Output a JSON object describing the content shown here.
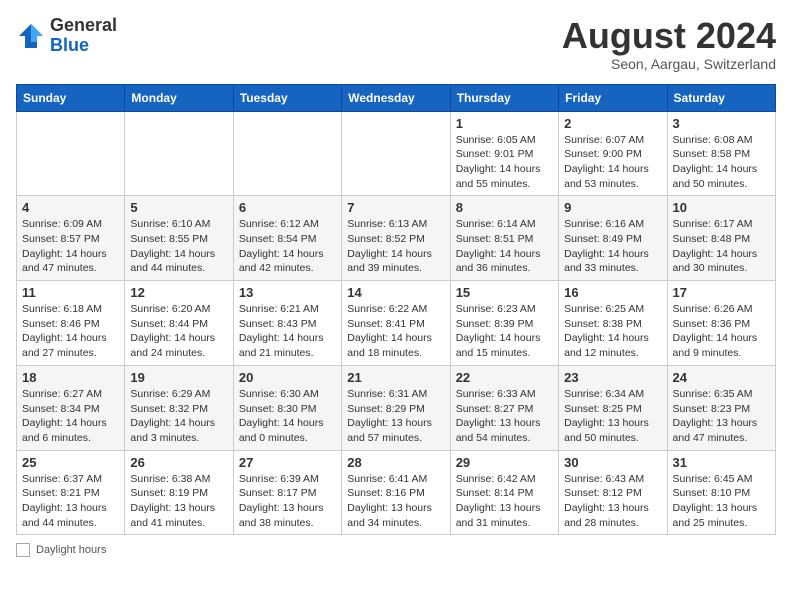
{
  "header": {
    "logo_line1": "General",
    "logo_line2": "Blue",
    "month_title": "August 2024",
    "location": "Seon, Aargau, Switzerland"
  },
  "weekdays": [
    "Sunday",
    "Monday",
    "Tuesday",
    "Wednesday",
    "Thursday",
    "Friday",
    "Saturday"
  ],
  "weeks": [
    [
      {
        "day": "",
        "info": ""
      },
      {
        "day": "",
        "info": ""
      },
      {
        "day": "",
        "info": ""
      },
      {
        "day": "",
        "info": ""
      },
      {
        "day": "1",
        "info": "Sunrise: 6:05 AM\nSunset: 9:01 PM\nDaylight: 14 hours and 55 minutes."
      },
      {
        "day": "2",
        "info": "Sunrise: 6:07 AM\nSunset: 9:00 PM\nDaylight: 14 hours and 53 minutes."
      },
      {
        "day": "3",
        "info": "Sunrise: 6:08 AM\nSunset: 8:58 PM\nDaylight: 14 hours and 50 minutes."
      }
    ],
    [
      {
        "day": "4",
        "info": "Sunrise: 6:09 AM\nSunset: 8:57 PM\nDaylight: 14 hours and 47 minutes."
      },
      {
        "day": "5",
        "info": "Sunrise: 6:10 AM\nSunset: 8:55 PM\nDaylight: 14 hours and 44 minutes."
      },
      {
        "day": "6",
        "info": "Sunrise: 6:12 AM\nSunset: 8:54 PM\nDaylight: 14 hours and 42 minutes."
      },
      {
        "day": "7",
        "info": "Sunrise: 6:13 AM\nSunset: 8:52 PM\nDaylight: 14 hours and 39 minutes."
      },
      {
        "day": "8",
        "info": "Sunrise: 6:14 AM\nSunset: 8:51 PM\nDaylight: 14 hours and 36 minutes."
      },
      {
        "day": "9",
        "info": "Sunrise: 6:16 AM\nSunset: 8:49 PM\nDaylight: 14 hours and 33 minutes."
      },
      {
        "day": "10",
        "info": "Sunrise: 6:17 AM\nSunset: 8:48 PM\nDaylight: 14 hours and 30 minutes."
      }
    ],
    [
      {
        "day": "11",
        "info": "Sunrise: 6:18 AM\nSunset: 8:46 PM\nDaylight: 14 hours and 27 minutes."
      },
      {
        "day": "12",
        "info": "Sunrise: 6:20 AM\nSunset: 8:44 PM\nDaylight: 14 hours and 24 minutes."
      },
      {
        "day": "13",
        "info": "Sunrise: 6:21 AM\nSunset: 8:43 PM\nDaylight: 14 hours and 21 minutes."
      },
      {
        "day": "14",
        "info": "Sunrise: 6:22 AM\nSunset: 8:41 PM\nDaylight: 14 hours and 18 minutes."
      },
      {
        "day": "15",
        "info": "Sunrise: 6:23 AM\nSunset: 8:39 PM\nDaylight: 14 hours and 15 minutes."
      },
      {
        "day": "16",
        "info": "Sunrise: 6:25 AM\nSunset: 8:38 PM\nDaylight: 14 hours and 12 minutes."
      },
      {
        "day": "17",
        "info": "Sunrise: 6:26 AM\nSunset: 8:36 PM\nDaylight: 14 hours and 9 minutes."
      }
    ],
    [
      {
        "day": "18",
        "info": "Sunrise: 6:27 AM\nSunset: 8:34 PM\nDaylight: 14 hours and 6 minutes."
      },
      {
        "day": "19",
        "info": "Sunrise: 6:29 AM\nSunset: 8:32 PM\nDaylight: 14 hours and 3 minutes."
      },
      {
        "day": "20",
        "info": "Sunrise: 6:30 AM\nSunset: 8:30 PM\nDaylight: 14 hours and 0 minutes."
      },
      {
        "day": "21",
        "info": "Sunrise: 6:31 AM\nSunset: 8:29 PM\nDaylight: 13 hours and 57 minutes."
      },
      {
        "day": "22",
        "info": "Sunrise: 6:33 AM\nSunset: 8:27 PM\nDaylight: 13 hours and 54 minutes."
      },
      {
        "day": "23",
        "info": "Sunrise: 6:34 AM\nSunset: 8:25 PM\nDaylight: 13 hours and 50 minutes."
      },
      {
        "day": "24",
        "info": "Sunrise: 6:35 AM\nSunset: 8:23 PM\nDaylight: 13 hours and 47 minutes."
      }
    ],
    [
      {
        "day": "25",
        "info": "Sunrise: 6:37 AM\nSunset: 8:21 PM\nDaylight: 13 hours and 44 minutes."
      },
      {
        "day": "26",
        "info": "Sunrise: 6:38 AM\nSunset: 8:19 PM\nDaylight: 13 hours and 41 minutes."
      },
      {
        "day": "27",
        "info": "Sunrise: 6:39 AM\nSunset: 8:17 PM\nDaylight: 13 hours and 38 minutes."
      },
      {
        "day": "28",
        "info": "Sunrise: 6:41 AM\nSunset: 8:16 PM\nDaylight: 13 hours and 34 minutes."
      },
      {
        "day": "29",
        "info": "Sunrise: 6:42 AM\nSunset: 8:14 PM\nDaylight: 13 hours and 31 minutes."
      },
      {
        "day": "30",
        "info": "Sunrise: 6:43 AM\nSunset: 8:12 PM\nDaylight: 13 hours and 28 minutes."
      },
      {
        "day": "31",
        "info": "Sunrise: 6:45 AM\nSunset: 8:10 PM\nDaylight: 13 hours and 25 minutes."
      }
    ]
  ],
  "legend": {
    "label": "Daylight hours"
  }
}
